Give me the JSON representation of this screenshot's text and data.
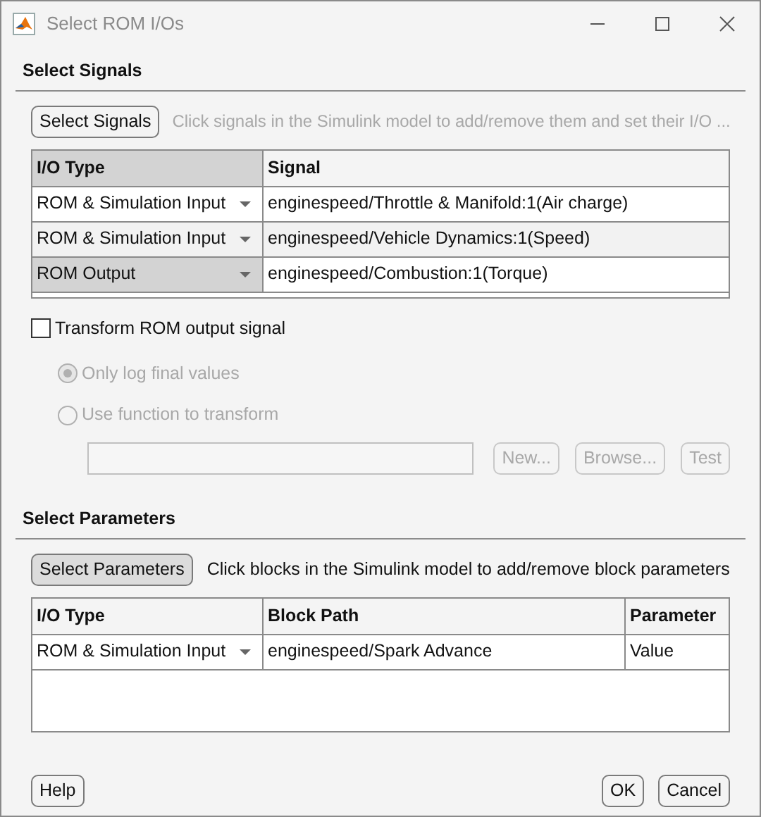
{
  "window": {
    "title": "Select ROM I/Os"
  },
  "signals_section": {
    "heading": "Select Signals",
    "button": {
      "label": "Select Signals",
      "highlighted": false
    },
    "hint": {
      "text": "Click signals in the Simulink model to add/remove them and set their I/O ...",
      "disabled": true
    },
    "table": {
      "columns": [
        {
          "label": "I/O Type",
          "selected": true
        },
        {
          "label": "Signal",
          "selected": false
        }
      ],
      "rows": [
        {
          "io_type": "ROM & Simulation Input",
          "signal": "enginespeed/Throttle & Manifold:1(Air charge)",
          "selected": false
        },
        {
          "io_type": "ROM & Simulation Input",
          "signal": "enginespeed/Vehicle Dynamics:1(Speed)",
          "selected": false
        },
        {
          "io_type": "ROM Output",
          "signal": "enginespeed/Combustion:1(Torque)",
          "selected": true
        }
      ]
    }
  },
  "transform": {
    "checkbox": {
      "label": "Transform ROM output signal",
      "checked": false
    },
    "options": [
      {
        "label": "Only log final values",
        "selected": true,
        "disabled": true
      },
      {
        "label": "Use function to transform",
        "selected": false,
        "disabled": true
      }
    ],
    "function_field": {
      "disabled": true
    },
    "buttons": [
      {
        "label": "New...",
        "disabled": true
      },
      {
        "label": "Browse...",
        "disabled": true
      },
      {
        "label": "Test",
        "disabled": true
      }
    ]
  },
  "parameters_section": {
    "heading": "Select Parameters",
    "button": {
      "label": "Select Parameters",
      "highlighted": true
    },
    "hint": {
      "text": "Click blocks in the Simulink model to add/remove block parameters",
      "disabled": false
    },
    "table": {
      "columns": [
        {
          "label": "I/O Type",
          "selected": false
        },
        {
          "label": "Block Path",
          "selected": false
        },
        {
          "label": "Parameter",
          "selected": false
        }
      ],
      "rows": [
        {
          "io_type": "ROM & Simulation Input",
          "block_path": "enginespeed/Spark Advance",
          "parameter": "Value",
          "selected": false
        }
      ]
    }
  },
  "footer": {
    "left_buttons": [
      {
        "label": "Help"
      }
    ],
    "right_buttons": [
      {
        "label": "OK"
      },
      {
        "label": "Cancel"
      }
    ]
  }
}
